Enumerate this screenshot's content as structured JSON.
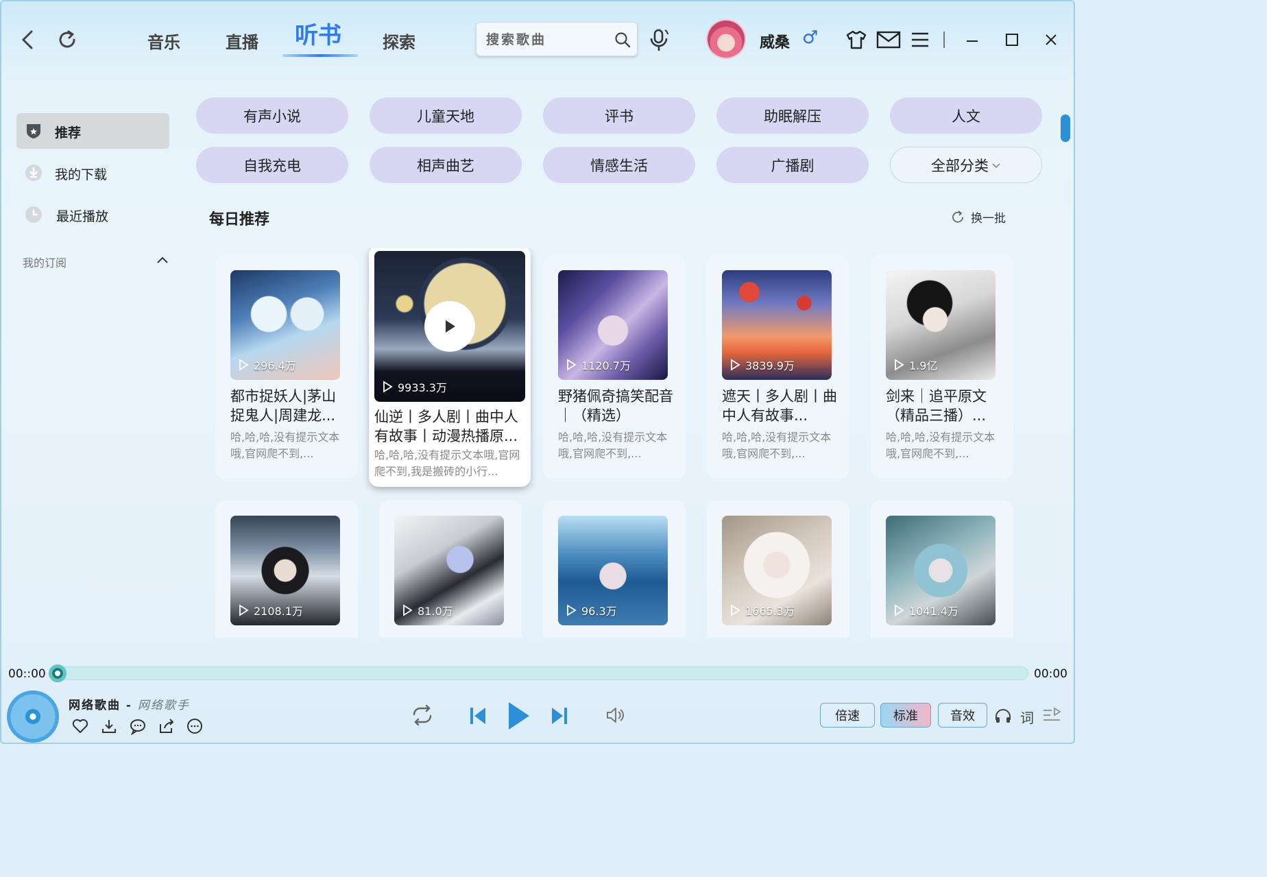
{
  "topbar": {
    "tabs": [
      {
        "label": "音乐"
      },
      {
        "label": "直播"
      },
      {
        "label": "听书"
      },
      {
        "label": "探索"
      }
    ],
    "active_tab": "听书",
    "search_placeholder": "搜索歌曲",
    "username": "威桑",
    "gender_symbol": "♂"
  },
  "sidebar": {
    "items": [
      {
        "label": "推荐",
        "icon": "shield-star-icon",
        "active": true
      },
      {
        "label": "我的下载",
        "icon": "download-icon"
      },
      {
        "label": "最近播放",
        "icon": "clock-icon"
      }
    ],
    "subscription_title": "我的订阅"
  },
  "categories": [
    "有声小说",
    "儿童天地",
    "评书",
    "助眠解压",
    "人文",
    "自我充电",
    "相声曲艺",
    "情感生活",
    "广播剧",
    "全部分类"
  ],
  "section": {
    "title": "每日推荐",
    "refresh_label": "换一批"
  },
  "cards": [
    {
      "plays": "296.4万",
      "title": "都市捉妖人|茅山捉鬼人|周建龙...",
      "desc": "哈,哈,哈,没有提示文本哦,官网爬不到,..."
    },
    {
      "plays": "9933.3万",
      "title": "仙逆丨多人剧丨曲中人有故事丨动漫热播原...",
      "desc": "哈,哈,哈,没有提示文本哦,官网爬不到,我是搬砖的小行..."
    },
    {
      "plays": "1120.7万",
      "title": "野猪佩奇搞笑配音｜（精选）",
      "desc": "哈,哈,哈,没有提示文本哦,官网爬不到,..."
    },
    {
      "plays": "3839.9万",
      "title": "遮天丨多人剧丨曲中人有故事...",
      "desc": "哈,哈,哈,没有提示文本哦,官网爬不到,..."
    },
    {
      "plays": "1.9亿",
      "title": "剑来｜追平原文（精品三播）...",
      "desc": "哈,哈,哈,没有提示文本哦,官网爬不到,..."
    },
    {
      "plays": "2108.1万",
      "title": "",
      "desc": ""
    },
    {
      "plays": "81.0万",
      "title": "",
      "desc": ""
    },
    {
      "plays": "96.3万",
      "title": "",
      "desc": ""
    },
    {
      "plays": "1665.3万",
      "title": "",
      "desc": ""
    },
    {
      "plays": "1041.4万",
      "title": "",
      "desc": ""
    }
  ],
  "player": {
    "time_current": "00::00",
    "time_total": "00:00",
    "progress": 0,
    "song_name": "网络歌曲",
    "separator": " - ",
    "singer": "网络歌手",
    "speed_label": "倍速",
    "quality_label": "标准",
    "effect_label": "音效",
    "lyrics_label": "词"
  },
  "colors": {
    "accent": "#2f7bf0",
    "category_bg": "#d7d6f3",
    "progress_bg": "#c9ecef",
    "knob": "#5fc6c2"
  }
}
